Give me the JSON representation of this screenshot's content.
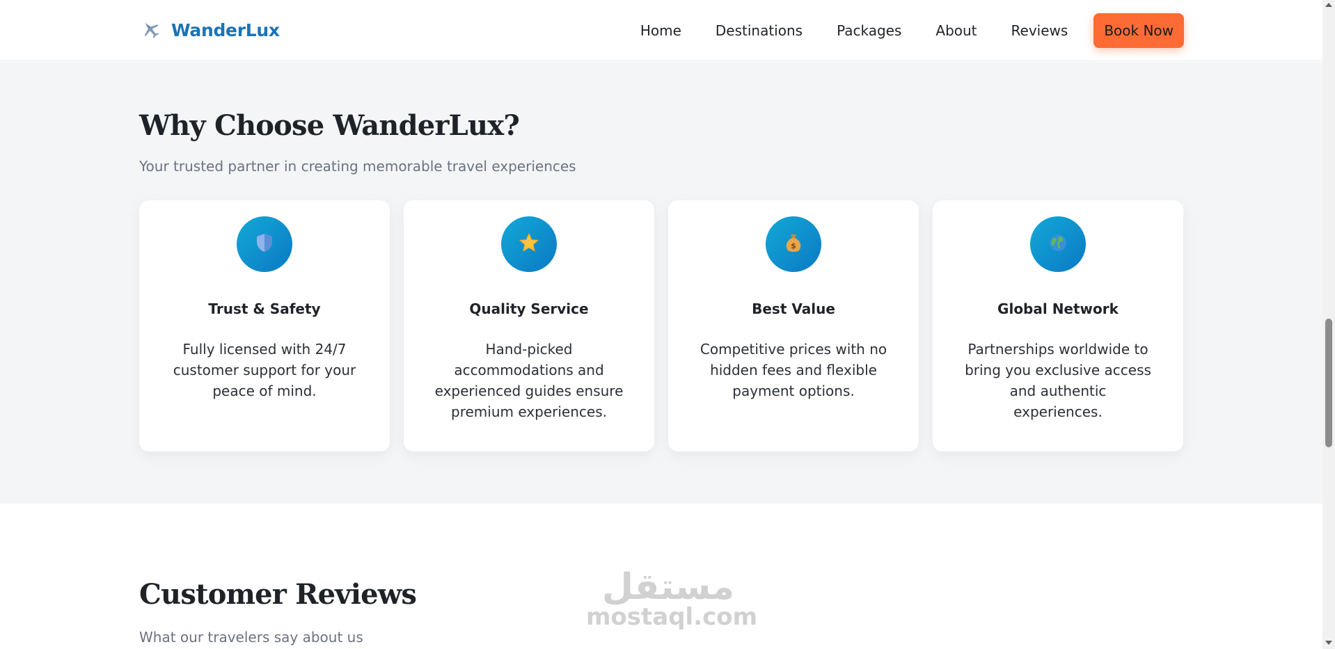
{
  "header": {
    "brand": "WanderLux",
    "nav": [
      "Home",
      "Destinations",
      "Packages",
      "About",
      "Reviews"
    ],
    "cta": "Book Now"
  },
  "why": {
    "title": "Why Choose WanderLux?",
    "subtitle": "Your trusted partner in creating memorable travel experiences",
    "cards": [
      {
        "icon": "shield-icon",
        "title": "Trust & Safety",
        "text": "Fully licensed with 24/7 customer support for your peace of mind."
      },
      {
        "icon": "star-icon",
        "title": "Quality Service",
        "text": "Hand-picked accommodations and experienced guides ensure premium experiences."
      },
      {
        "icon": "money-bag-icon",
        "title": "Best Value",
        "text": "Competitive prices with no hidden fees and flexible payment options."
      },
      {
        "icon": "globe-icon",
        "title": "Global Network",
        "text": "Partnerships worldwide to bring you exclusive access and authentic experiences."
      }
    ]
  },
  "reviews": {
    "title": "Customer Reviews",
    "subtitle": "What our travelers say about us"
  },
  "watermark": {
    "arabic": "مستقل",
    "latin": "mostaql.com"
  },
  "colors": {
    "brand": "#1a73b8",
    "cta": "#ff6b35",
    "icon_gradient_start": "#12a9d6",
    "icon_gradient_end": "#0b79c4",
    "section_bg": "#f4f5f7"
  }
}
